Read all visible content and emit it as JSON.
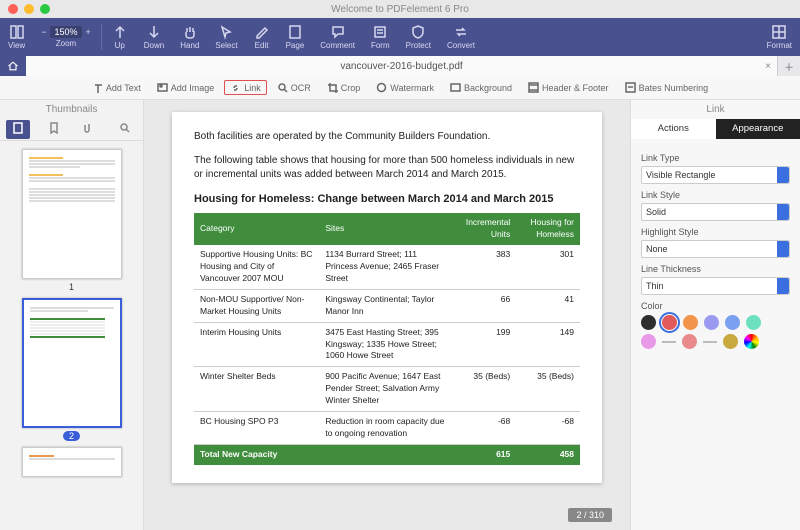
{
  "app_title": "Welcome to PDFelement 6 Pro",
  "file_tab": "vancouver-2016-budget.pdf",
  "page_counter": "2 / 310",
  "zoom": "150%",
  "toolbar": {
    "view": "View",
    "zoom": "Zoom",
    "up": "Up",
    "down": "Down",
    "hand": "Hand",
    "select": "Select",
    "edit": "Edit",
    "page": "Page",
    "comment": "Comment",
    "form": "Form",
    "protect": "Protect",
    "convert": "Convert",
    "format": "Format"
  },
  "subtoolbar": {
    "add_text": "Add Text",
    "add_image": "Add Image",
    "link": "Link",
    "ocr": "OCR",
    "crop": "Crop",
    "watermark": "Watermark",
    "background": "Background",
    "header_footer": "Header & Footer",
    "bates": "Bates Numbering"
  },
  "thumbs": {
    "title": "Thumbnails",
    "labels": [
      "1",
      "2"
    ]
  },
  "doc": {
    "para1": "Both facilities are operated by the Community Builders Foundation.",
    "para2": "The following table shows that housing for more than 500 homeless individuals in new or incremental units was added between March 2014 and March 2015.",
    "table_title": "Housing for Homeless: Change between March 2014 and March 2015",
    "headers": [
      "Category",
      "Sites",
      "Incremental Units",
      "Housing for Homeless"
    ],
    "rows": [
      {
        "cat": "Supportive Housing Units: BC Housing and City of Vancouver 2007 MOU",
        "site": "1134 Burrard Street; 111 Princess Avenue; 2465 Fraser Street",
        "inc": "383",
        "hh": "301"
      },
      {
        "cat": "Non-MOU Supportive/ Non-Market Housing Units",
        "site": "Kingsway Continental; Taylor Manor Inn",
        "inc": "66",
        "hh": "41"
      },
      {
        "cat": "Interim Housing Units",
        "site": "3475 East Hasting Street; 395 Kingsway; 1335 Howe Street; 1060 Howe Street",
        "inc": "199",
        "hh": "149"
      },
      {
        "cat": "Winter Shelter Beds",
        "site": "900 Pacific Avenue; 1647 East Pender Street; Salvation Army Winter Shelter",
        "inc": "35 (Beds)",
        "hh": "35 (Beds)"
      },
      {
        "cat": "BC Housing SPO P3",
        "site": "Reduction in room capacity due to ongoing renovation",
        "inc": "-68",
        "hh": "-68"
      }
    ],
    "total": {
      "cat": "Total New Capacity",
      "inc": "615",
      "hh": "458"
    }
  },
  "props": {
    "title": "Link",
    "tabs": {
      "actions": "Actions",
      "appearance": "Appearance"
    },
    "link_type": {
      "label": "Link Type",
      "value": "Visible Rectangle"
    },
    "link_style": {
      "label": "Link Style",
      "value": "Solid"
    },
    "highlight_style": {
      "label": "Highlight Style",
      "value": "None"
    },
    "line_thickness": {
      "label": "Line Thickness",
      "value": "Thin"
    },
    "color_label": "Color",
    "colors_row1": [
      "#2e2e2e",
      "#e05a5a",
      "#f2944a",
      "#9a9af0",
      "#7aa0f2",
      "#6de0c0"
    ],
    "colors_row2": [
      "#e89ae8",
      "#e88a8a",
      "#c7a93e"
    ],
    "selected_color": 1
  }
}
